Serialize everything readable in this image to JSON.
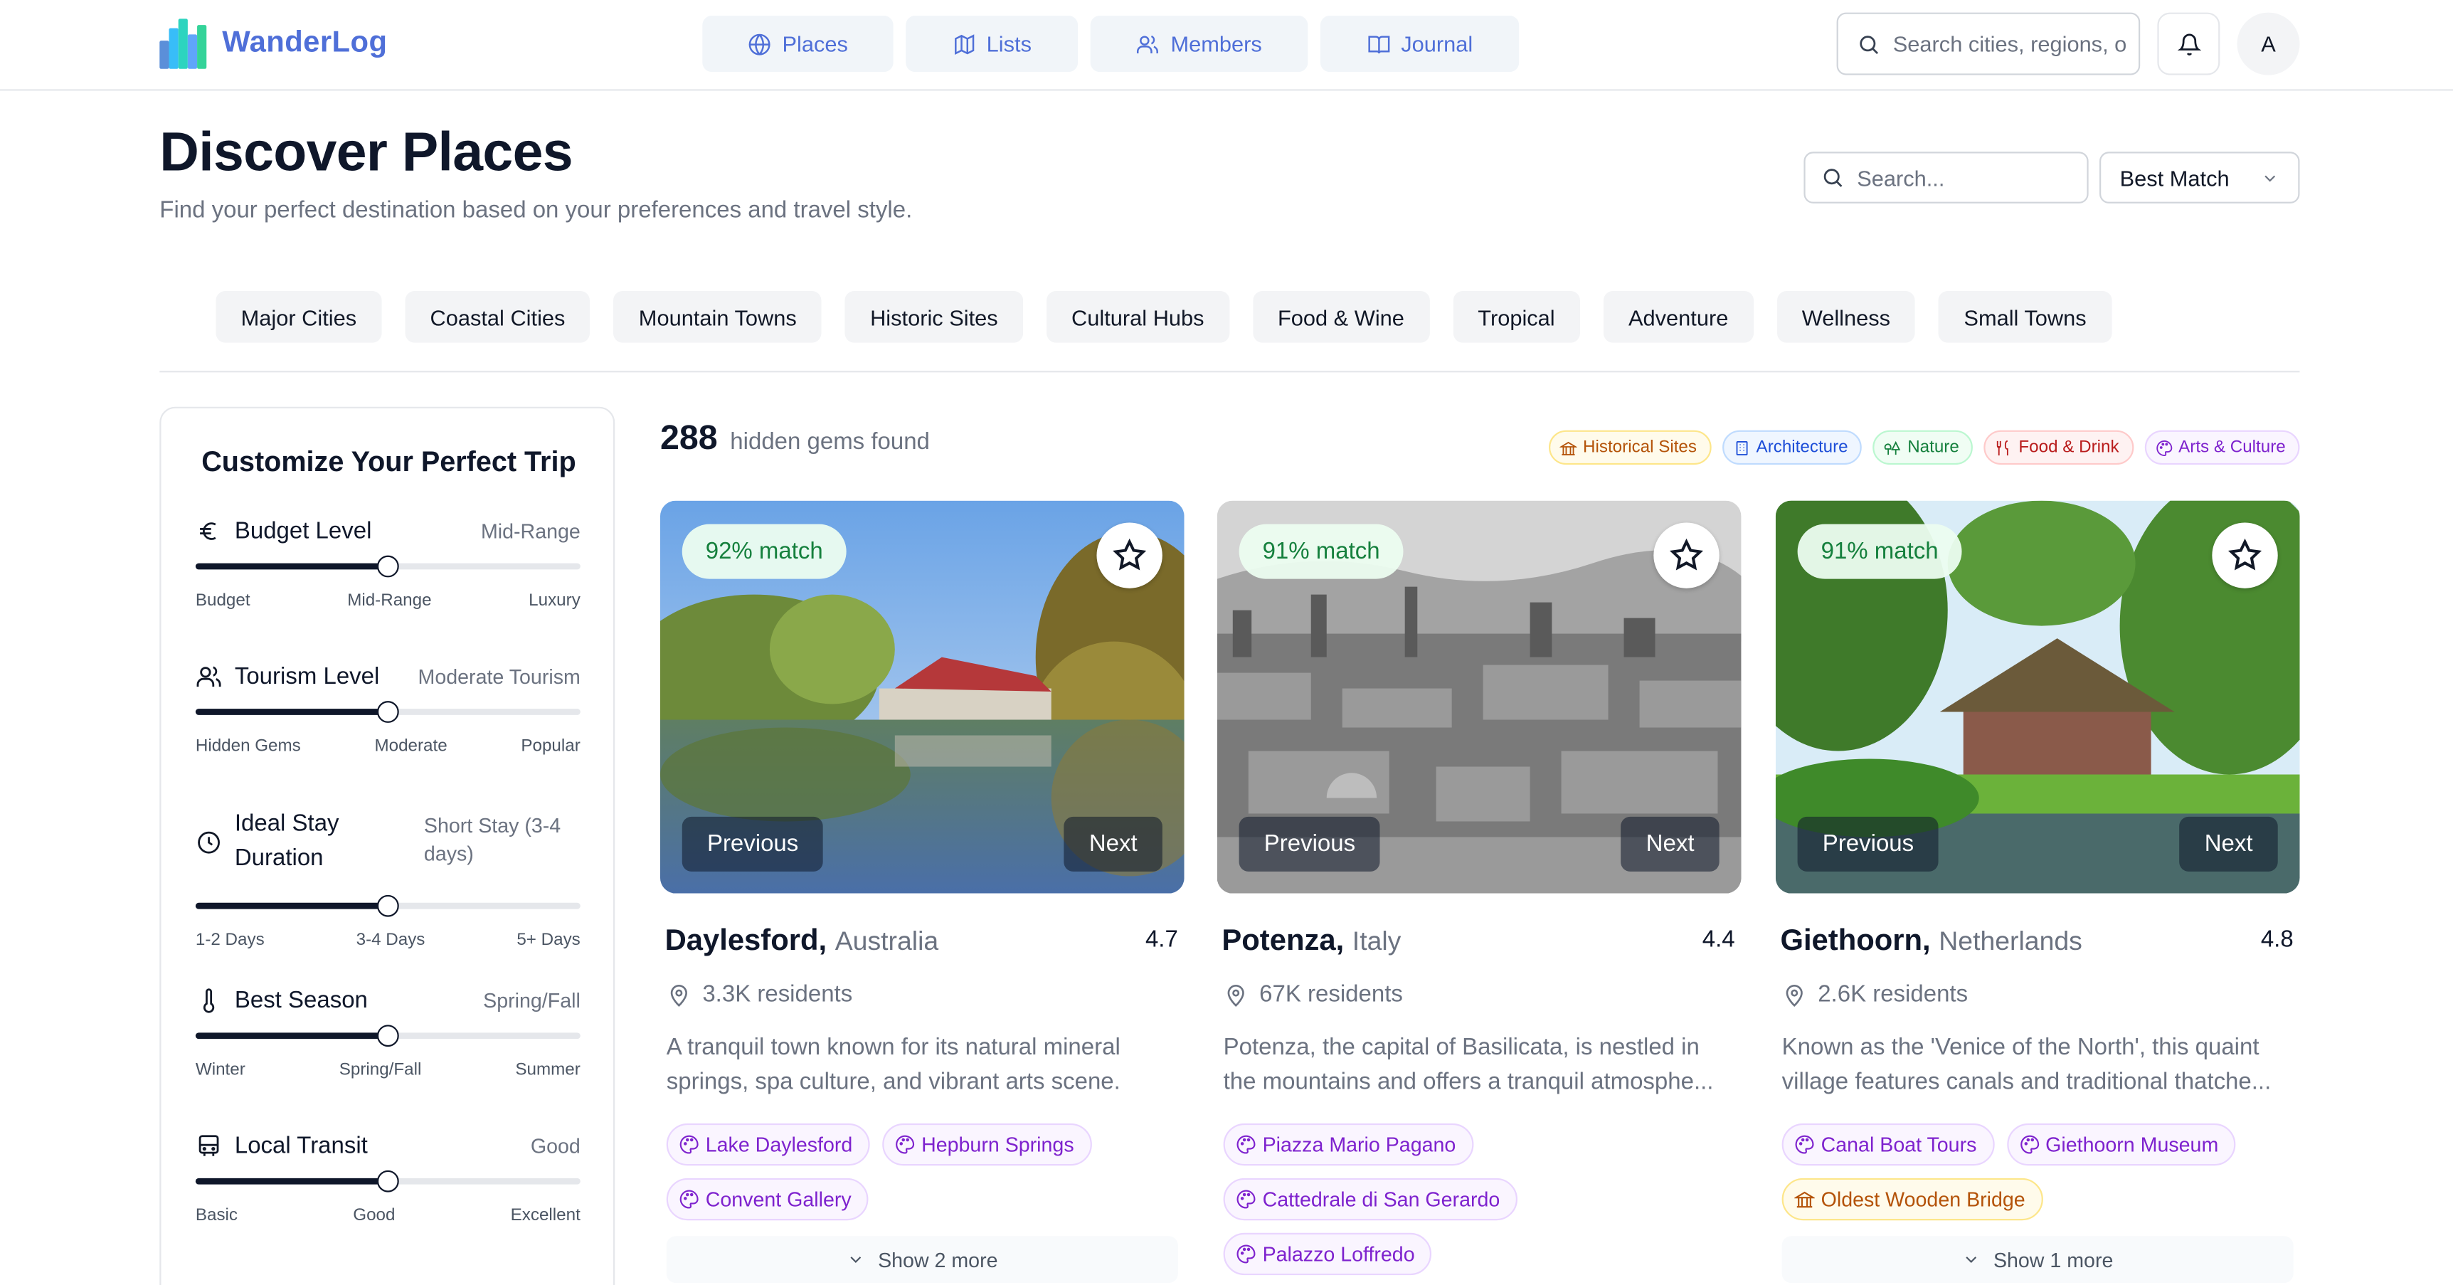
{
  "header": {
    "app_name": "WanderLog",
    "nav": [
      {
        "label": "Places",
        "icon": "globe-icon"
      },
      {
        "label": "Lists",
        "icon": "map-icon"
      },
      {
        "label": "Members",
        "icon": "users-icon"
      },
      {
        "label": "Journal",
        "icon": "book-open-icon"
      }
    ],
    "search_placeholder": "Search cities, regions, o",
    "avatar_initial": "A"
  },
  "page": {
    "title": "Discover Places",
    "subtitle": "Find your perfect destination based on your preferences and travel style.",
    "search_placeholder": "Search...",
    "sort_value": "Best Match"
  },
  "categories": [
    "Major Cities",
    "Coastal Cities",
    "Mountain Towns",
    "Historic Sites",
    "Cultural Hubs",
    "Food & Wine",
    "Tropical",
    "Adventure",
    "Wellness",
    "Small Towns"
  ],
  "sidebar": {
    "title": "Customize Your Perfect Trip",
    "filters": [
      {
        "label": "Budget Level",
        "value": "Mid-Range",
        "icon": "euro-icon",
        "level": 0.5,
        "ticks": [
          "Budget",
          "Mid-Range",
          "Luxury"
        ]
      },
      {
        "label": "Tourism Level",
        "value": "Moderate Tourism",
        "icon": "users-icon",
        "level": 0.5,
        "ticks": [
          "Hidden Gems",
          "Moderate",
          "Popular"
        ]
      },
      {
        "label": "Ideal Stay Duration",
        "value": "Short Stay (3-4 days)",
        "icon": "clock-icon",
        "level": 0.5,
        "ticks": [
          "1-2 Days",
          "3-4 Days",
          "5+ Days"
        ]
      },
      {
        "label": "Best Season",
        "value": "Spring/Fall",
        "icon": "thermometer-icon",
        "level": 0.5,
        "ticks": [
          "Winter",
          "Spring/Fall",
          "Summer"
        ]
      },
      {
        "label": "Local Transit",
        "value": "Good",
        "icon": "bus-icon",
        "level": 0.5,
        "ticks": [
          "Basic",
          "Good",
          "Excellent"
        ]
      }
    ]
  },
  "results": {
    "count": "288",
    "count_label": "hidden gems found",
    "legend": [
      {
        "label": "Historical Sites",
        "color": "#b45309"
      },
      {
        "label": "Architecture",
        "color": "#1d4ed8"
      },
      {
        "label": "Nature",
        "color": "#15803d"
      },
      {
        "label": "Food & Drink",
        "color": "#b91c1c"
      },
      {
        "label": "Arts & Culture",
        "color": "#7e22ce"
      }
    ]
  },
  "cards": [
    {
      "match": "92% match",
      "city": "Daylesford,",
      "country": "Australia",
      "rating": "4.7",
      "residents": "3.3K residents",
      "description": [
        "A tranquil town known for its natural mineral",
        "springs, spa culture, and vibrant arts scene."
      ],
      "tags": [
        {
          "label": "Lake Daylesford",
          "type": "arts"
        },
        {
          "label": "Hepburn Springs",
          "type": "arts"
        },
        {
          "label": "Convent Gallery",
          "type": "arts"
        }
      ],
      "more": "Show 2 more",
      "prev": "Previous",
      "next": "Next"
    },
    {
      "match": "91% match",
      "city": "Potenza,",
      "country": "Italy",
      "rating": "4.4",
      "residents": "67K residents",
      "description": [
        "Potenza, the capital of Basilicata, is nestled in",
        "the mountains and offers a tranquil atmosphe..."
      ],
      "tags": [
        {
          "label": "Piazza Mario Pagano",
          "type": "arts"
        },
        {
          "label": "Cattedrale di San Gerardo",
          "type": "arts"
        },
        {
          "label": "Palazzo Loffredo",
          "type": "arts"
        }
      ],
      "more": "",
      "prev": "Previous",
      "next": "Next"
    },
    {
      "match": "91% match",
      "city": "Giethoorn,",
      "country": "Netherlands",
      "rating": "4.8",
      "residents": "2.6K residents",
      "description": [
        "Known as the 'Venice of the North', this quaint",
        "village features canals and traditional thatche..."
      ],
      "tags": [
        {
          "label": "Canal Boat Tours",
          "type": "arts"
        },
        {
          "label": "Giethoorn Museum",
          "type": "arts"
        },
        {
          "label": "Oldest Wooden Bridge",
          "type": "hist"
        }
      ],
      "more": "Show 1 more",
      "prev": "Previous",
      "next": "Next"
    }
  ]
}
